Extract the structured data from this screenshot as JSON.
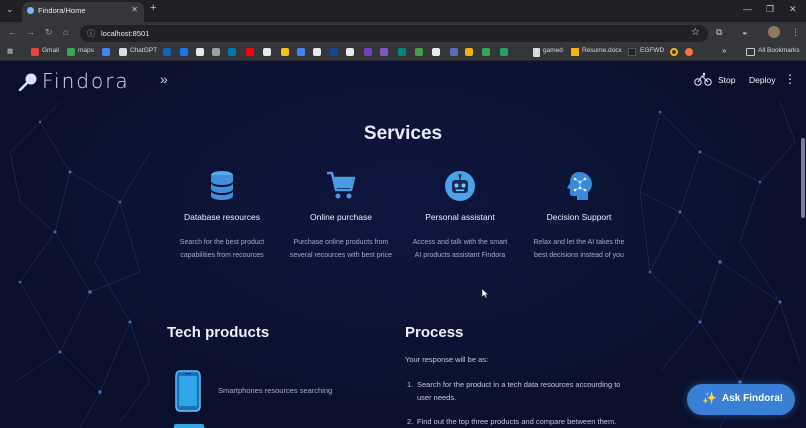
{
  "browser": {
    "tab_title": "Findora/Home",
    "tab_close": "✕",
    "new_tab": "+",
    "url": "localhost:8501",
    "bookmarks": [
      {
        "label": "Gmail",
        "color": "#ea4335"
      },
      {
        "label": "maps",
        "color": "#34a853"
      },
      {
        "label": "",
        "color": "#4285f4"
      },
      {
        "label": "ChatGPT",
        "color": "#dadce0"
      },
      {
        "label": "",
        "color": "#0a66c2"
      },
      {
        "label": "",
        "color": "#1877f2"
      },
      {
        "label": "",
        "color": "#e8eaed"
      },
      {
        "label": "",
        "color": "#9aa0a6"
      },
      {
        "label": "",
        "color": "#0077b5"
      },
      {
        "label": "",
        "color": "#ff0000"
      },
      {
        "label": "",
        "color": "#e8eaed"
      },
      {
        "label": "",
        "color": "#f5c518"
      },
      {
        "label": "",
        "color": "#4285f4"
      },
      {
        "label": "",
        "color": "#e8eaed"
      },
      {
        "label": "",
        "color": "#0d47a1"
      },
      {
        "label": "",
        "color": "#e8eaed"
      },
      {
        "label": "",
        "color": "#6f42c1"
      },
      {
        "label": "",
        "color": "#7e57c2"
      },
      {
        "label": "",
        "color": "#00897b"
      },
      {
        "label": "",
        "color": "#43a047"
      },
      {
        "label": "",
        "color": "#e8eaed"
      },
      {
        "label": "",
        "color": "#5c6bc0"
      },
      {
        "label": "",
        "color": "#f4b400"
      },
      {
        "label": "",
        "color": "#34a853"
      },
      {
        "label": "",
        "color": "#21a366"
      }
    ],
    "bookmark_gamed": "gamed",
    "bookmark_resume": "Resume.docx",
    "bookmark_egfwd": "EGFWD",
    "bookmarks_overflow": "»",
    "all_bookmarks": "All Bookmarks"
  },
  "app": {
    "brand": "Findora",
    "sidebar_toggle": "»",
    "stop_label": "Stop",
    "deploy_label": "Deploy",
    "menu_label": "⋮",
    "services_heading": "Services",
    "services": [
      {
        "title": "Database resources",
        "desc_line1": "Search for the best product",
        "desc_line2": "capabilities from recources",
        "icon": "database-icon"
      },
      {
        "title": "Online purchase",
        "desc_line1": "Purchase online products from",
        "desc_line2": "several recources with best price",
        "icon": "shopping-cart-icon"
      },
      {
        "title": "Personal assistant",
        "desc_line1": "Access and talk with the smart",
        "desc_line2": "AI products assistant Findora",
        "icon": "robot-icon"
      },
      {
        "title": "Decision Support",
        "desc_line1": "Relax and let the AI takes the",
        "desc_line2": "best decisions instead of you",
        "icon": "ai-brain-icon"
      }
    ],
    "tech_heading": "Tech products",
    "tech_items": [
      {
        "label": "Smartphones resources searching",
        "icon": "smartphone-icon"
      }
    ],
    "process_heading": "Process",
    "process_intro": "Your response will be as:",
    "process_steps": [
      {
        "num": "1.",
        "text": "Search for the product in a tech data resources accourding to user needs."
      },
      {
        "num": "2.",
        "text": "Find out the top three products and compare between them."
      }
    ],
    "ask_button": "Ask Findora!",
    "accent": "#3a7fd6"
  }
}
